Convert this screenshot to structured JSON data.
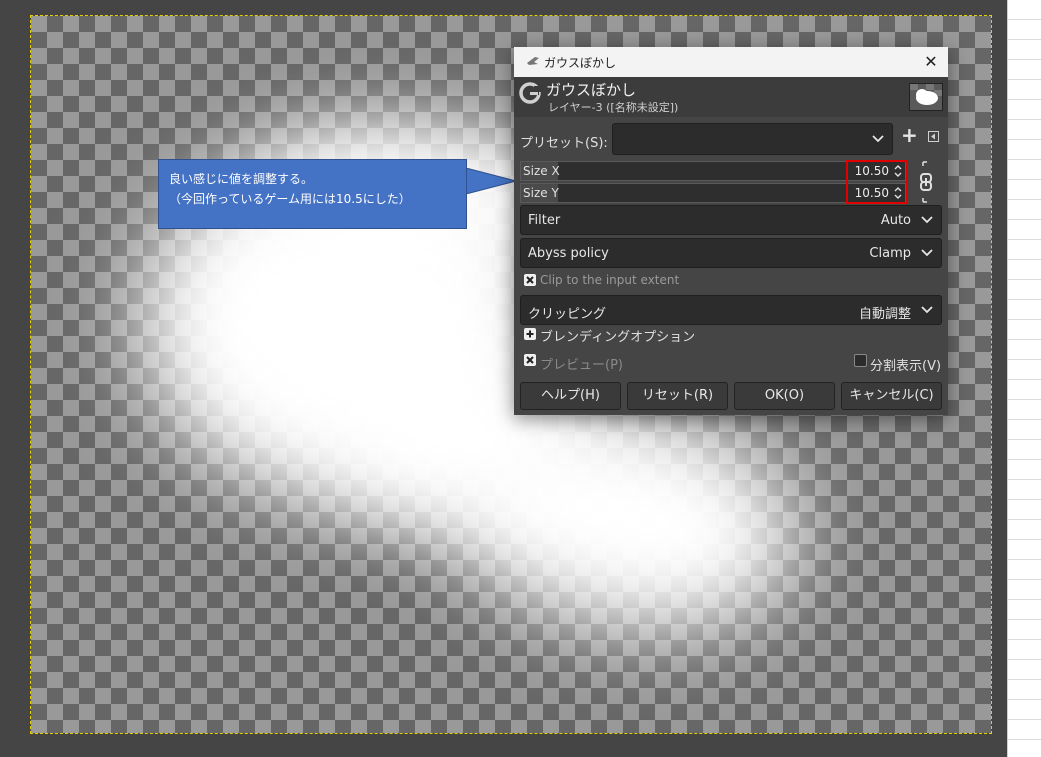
{
  "dialog": {
    "window_title": "ガウスぼかし",
    "title": "ガウスぼかし",
    "subtitle": "レイヤー-3 ([名称未設定])",
    "preset_label": "プリセット(S):",
    "preset_value": "",
    "size_x": {
      "label": "Size X",
      "value": "10.50"
    },
    "size_y": {
      "label": "Size Y",
      "value": "10.50"
    },
    "filter": {
      "label": "Filter",
      "value": "Auto"
    },
    "abyss": {
      "label": "Abyss policy",
      "value": "Clamp"
    },
    "clip_extent": {
      "label": "Clip to the input extent",
      "checked": true
    },
    "clipping": {
      "label": "クリッピング",
      "value": "自動調整"
    },
    "blending_label": "ブレンディングオプション",
    "preview": {
      "label": "プレビュー(P)",
      "checked": true
    },
    "split_view": {
      "label": "分割表示(V)",
      "checked": false
    },
    "buttons": {
      "help": "ヘルプ(H)",
      "reset": "リセット(R)",
      "ok": "OK(O)",
      "cancel": "キャンセル(C)"
    }
  },
  "callout": {
    "line1": "良い感じに値を調整する。",
    "line2": "（今回作っているゲーム用には10.5にした）"
  },
  "colors": {
    "callout": "#4472c4",
    "highlight": "#e00000",
    "dialog_bg": "#454545"
  }
}
